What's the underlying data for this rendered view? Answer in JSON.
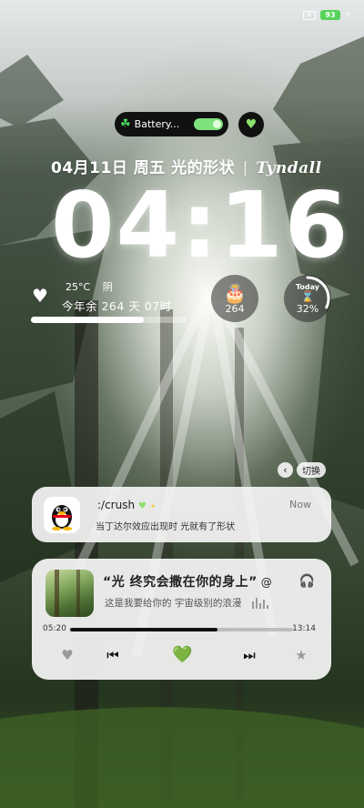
{
  "status_bar": {
    "sim_icon": "sim-crossed-icon",
    "battery_level": "93",
    "charging_icon": "bolt-icon",
    "battery_color": "#57d25a"
  },
  "widget_pill": {
    "icon": "clover-icon",
    "label": "Battery...",
    "toggle_on": true,
    "accent": "#7de27c"
  },
  "heart_button": {
    "icon": "green-heart-icon"
  },
  "date_line": {
    "date": "04月11日",
    "weekday": "周五",
    "phrase": "光的形状",
    "separator": "|",
    "word": "Tyndall"
  },
  "clock": {
    "time": "04:16"
  },
  "weather": {
    "icon": "pixel-heart-icon",
    "temperature": "25°C",
    "condition": "阴"
  },
  "year_remaining": {
    "text": "今年余 264 天 07时",
    "progress_fraction": 0.72
  },
  "countdown_widget": {
    "icon": "cake-icon",
    "value": "264"
  },
  "today_widget": {
    "label": "Today",
    "icon": "hourglass-icon",
    "percent": "32%",
    "fraction": 0.32
  },
  "switch": {
    "icon": "chevron-left-icon",
    "label": "切换"
  },
  "notification": {
    "app_icon": "qq-penguin-icon",
    "title": ":/crush",
    "title_decoration": "💚",
    "time": "Now",
    "body": "当丁达尔效应出现时  光就有了形状"
  },
  "music": {
    "song": "“光  终究会撒在你的身上”",
    "song_icon": "swirl-icon",
    "lyric": "这是我要给你的  宇宙级别的浪漫",
    "headphone_icon": "headphone-icon",
    "current_time": "05:20",
    "total_time": "13:14",
    "progress_fraction": 0.66,
    "controls": [
      "heart-icon",
      "previous-icon",
      "green-heart-icon",
      "next-icon",
      "star-icon"
    ]
  }
}
